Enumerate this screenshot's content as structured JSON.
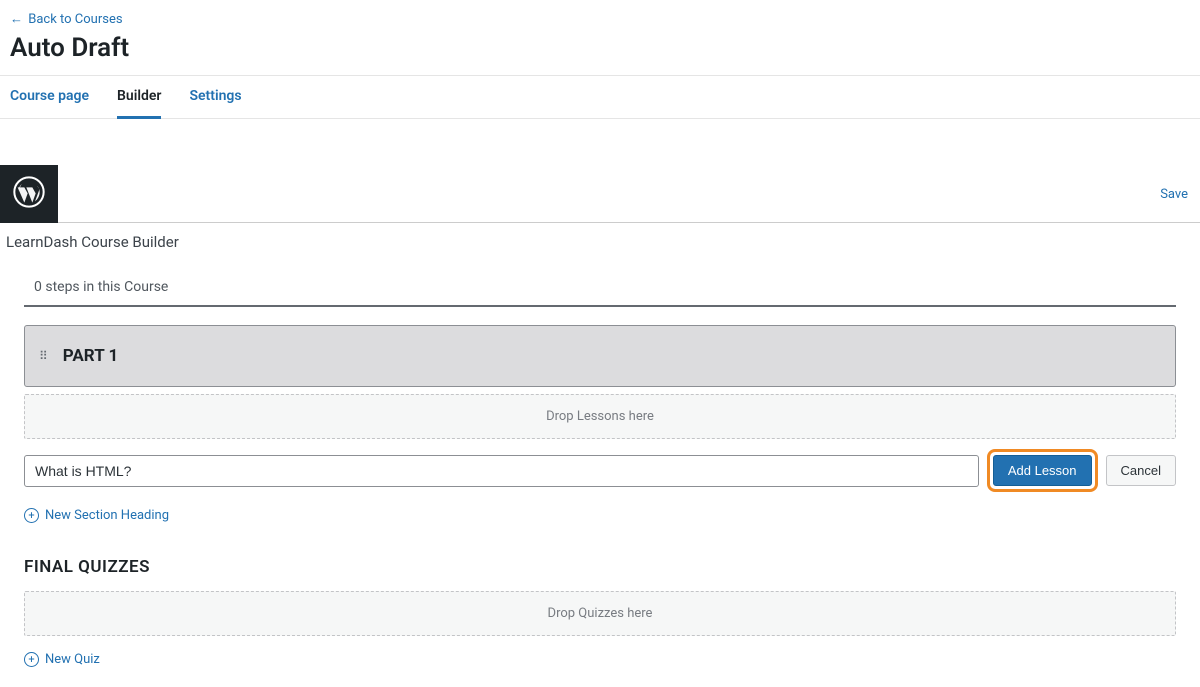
{
  "header": {
    "back_label": "Back to Courses",
    "title": "Auto Draft"
  },
  "tabs": [
    {
      "label": "Course page",
      "active": false
    },
    {
      "label": "Builder",
      "active": true
    },
    {
      "label": "Settings",
      "active": false
    }
  ],
  "topbar": {
    "save_label": "Save"
  },
  "builder": {
    "panel_title": "LearnDash Course Builder",
    "steps_text": "0 steps in this Course",
    "section1_title": "PART 1",
    "drop_lessons_text": "Drop Lessons here",
    "lesson_input_value": "What is HTML?",
    "add_lesson_label": "Add Lesson",
    "cancel_label": "Cancel",
    "new_section_label": "New Section Heading",
    "final_quizzes_title": "FINAL QUIZZES",
    "drop_quizzes_text": "Drop Quizzes here",
    "new_quiz_label": "New Quiz"
  }
}
